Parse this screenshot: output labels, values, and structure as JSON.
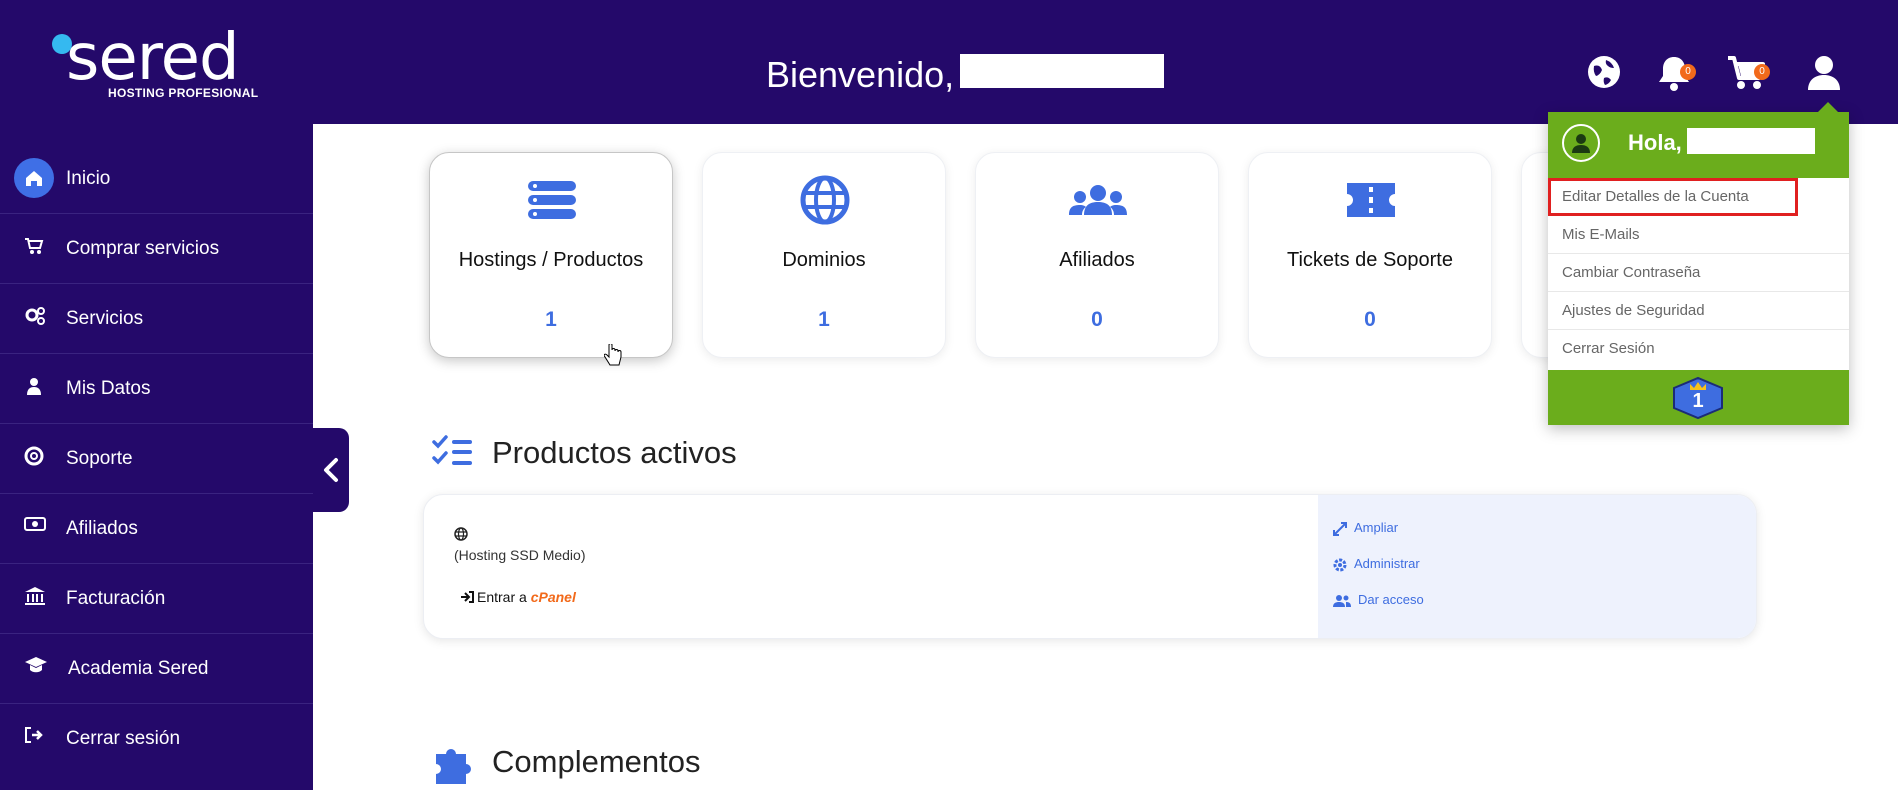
{
  "header": {
    "logo_text": "sered",
    "logo_sub": "HOSTING PROFESIONAL",
    "welcome": "Bienvenido,",
    "notifications_count": "0",
    "cart_count": "0"
  },
  "sidebar": {
    "items": [
      {
        "label": "Inicio",
        "icon": "home-icon"
      },
      {
        "label": "Comprar servicios",
        "icon": "cart-icon"
      },
      {
        "label": "Servicios",
        "icon": "gears-icon"
      },
      {
        "label": "Mis Datos",
        "icon": "user-icon"
      },
      {
        "label": "Soporte",
        "icon": "lifebuoy-icon"
      },
      {
        "label": "Afiliados",
        "icon": "money-icon"
      },
      {
        "label": "Facturación",
        "icon": "bank-icon"
      },
      {
        "label": "Academia Sered",
        "icon": "graduation-cap-icon"
      },
      {
        "label": "Cerrar sesión",
        "icon": "sign-out-icon"
      }
    ]
  },
  "cards": [
    {
      "title": "Hostings / Productos",
      "value": "1",
      "icon": "server-icon"
    },
    {
      "title": "Dominios",
      "value": "1",
      "icon": "globe-icon"
    },
    {
      "title": "Afiliados",
      "value": "0",
      "icon": "users-icon"
    },
    {
      "title": "Tickets de Soporte",
      "value": "0",
      "icon": "ticket-icon"
    }
  ],
  "sections": {
    "active_products": "Productos activos",
    "addons": "Complementos"
  },
  "product": {
    "plan": "(Hosting SSD Medio)",
    "login_label": "Entrar a",
    "cpanel": "cPanel",
    "actions": {
      "expand": "Ampliar",
      "manage": "Administrar",
      "grant": "Dar acceso"
    }
  },
  "dropdown": {
    "hello": "Hola,",
    "items": [
      "Editar Detalles de la Cuenta",
      "Mis E-Mails",
      "Cambiar Contraseña",
      "Ajustes de Seguridad",
      "Cerrar Sesión"
    ],
    "level": "1"
  },
  "colors": {
    "primary": "#24096a",
    "accent": "#3e6de0",
    "green": "#6bad1c",
    "badge": "#f26a1b"
  }
}
